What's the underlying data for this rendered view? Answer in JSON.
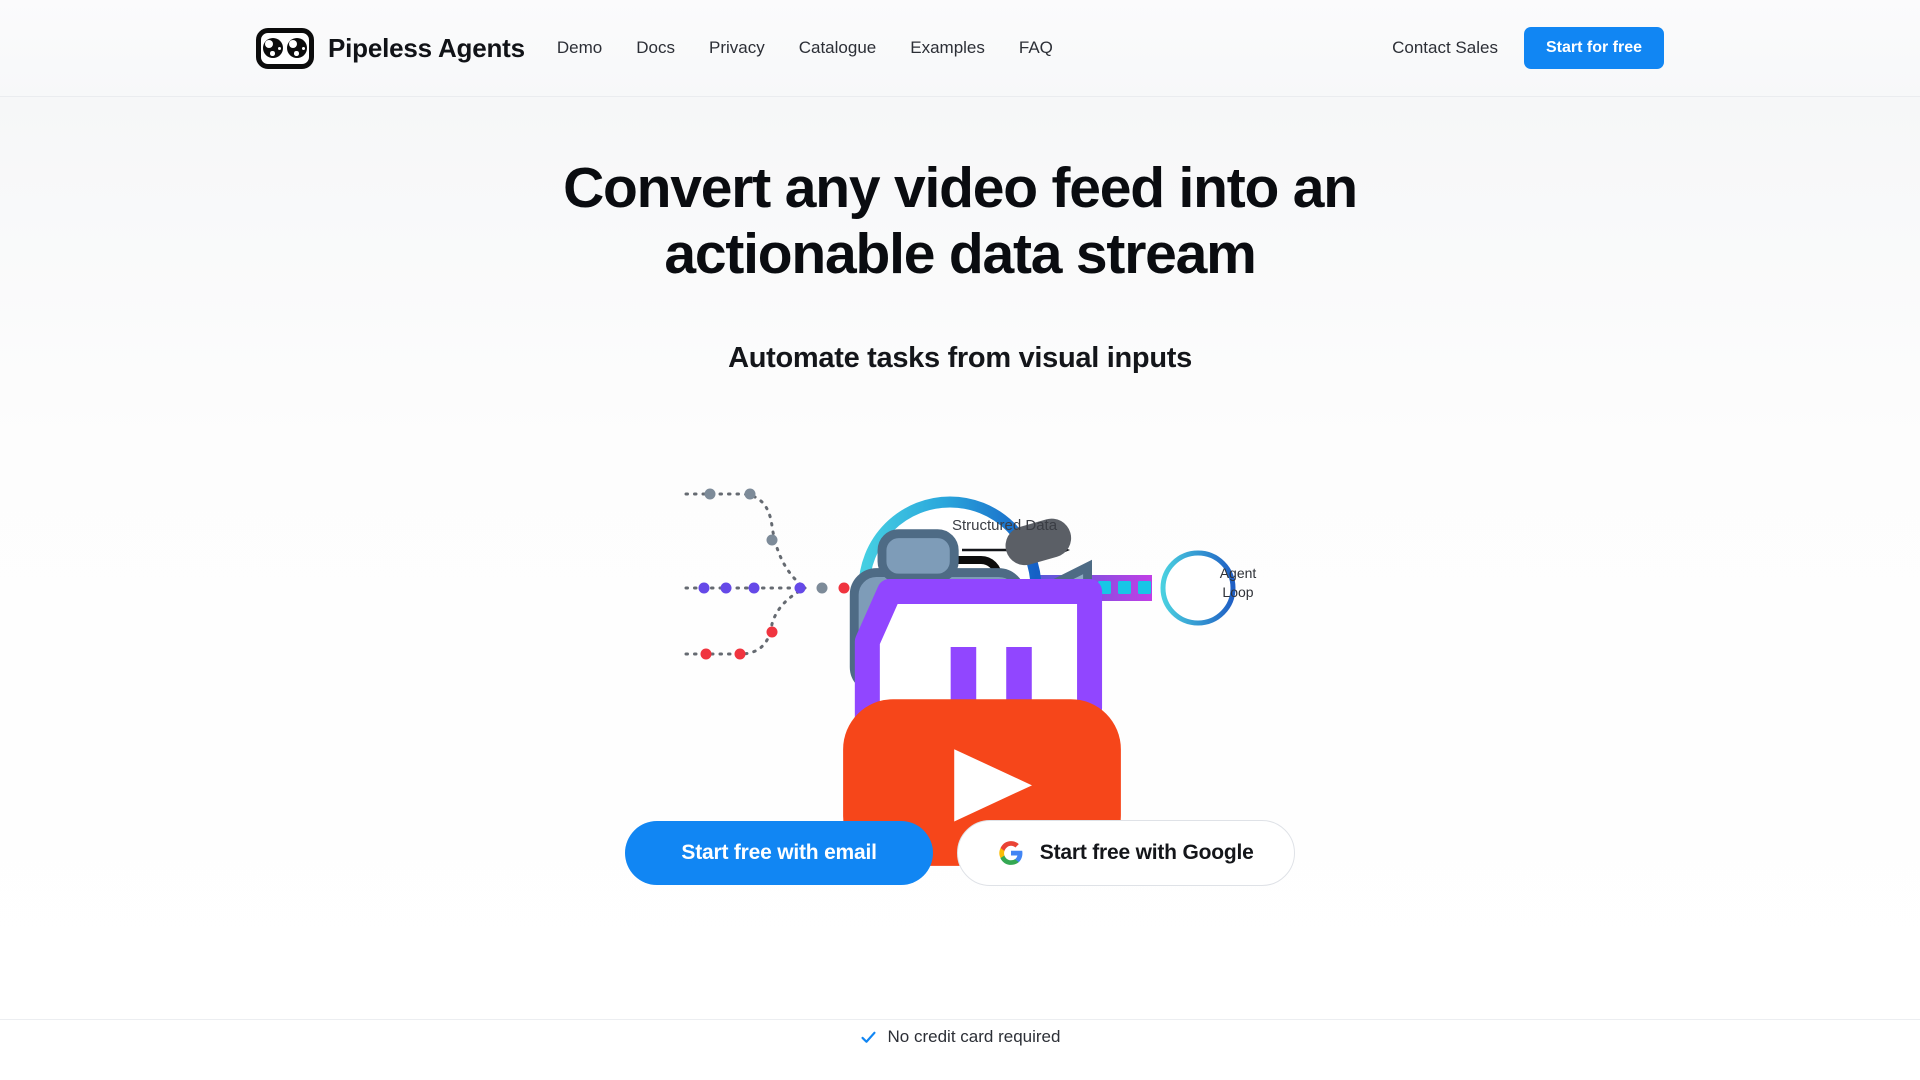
{
  "header": {
    "brand_name": "Pipeless Agents",
    "logo_icon": "pipeless-logo-icon",
    "nav": [
      {
        "label": "Demo"
      },
      {
        "label": "Docs"
      },
      {
        "label": "Privacy"
      },
      {
        "label": "Catalogue"
      },
      {
        "label": "Examples"
      },
      {
        "label": "FAQ"
      }
    ],
    "contact_sales_label": "Contact Sales",
    "start_free_label": "Start for free",
    "accent_color": "#1186f3"
  },
  "hero": {
    "headline_line1": "Convert any video feed into an",
    "headline_line2": "actionable data stream",
    "subheadline": "Automate tasks from visual inputs"
  },
  "diagram": {
    "sources": [
      {
        "name": "video-camera-icon",
        "label": "Video camera"
      },
      {
        "name": "twitch-icon",
        "label": "Twitch",
        "color": "#9146ff"
      },
      {
        "name": "youtube-icon",
        "label": "YouTube",
        "color": "#f6461a"
      }
    ],
    "hub_icon": "pipeless-logo-icon",
    "flow_label": "Structured Data",
    "agent_label_line1": "Agent",
    "agent_label_line2": "Loop",
    "ring_gradient_from": "#3fc8e0",
    "ring_gradient_to": "#1763c8",
    "pipe_gradient_from": "#1763c8",
    "pipe_gradient_to": "#b341e8",
    "packet_color": "#14c8e8"
  },
  "cta": {
    "email_button_label": "Start free with email",
    "google_button_label": "Start free with Google",
    "google_icon": "google-g-icon",
    "no_credit_card_label": "No credit card required",
    "check_icon": "check-icon"
  }
}
